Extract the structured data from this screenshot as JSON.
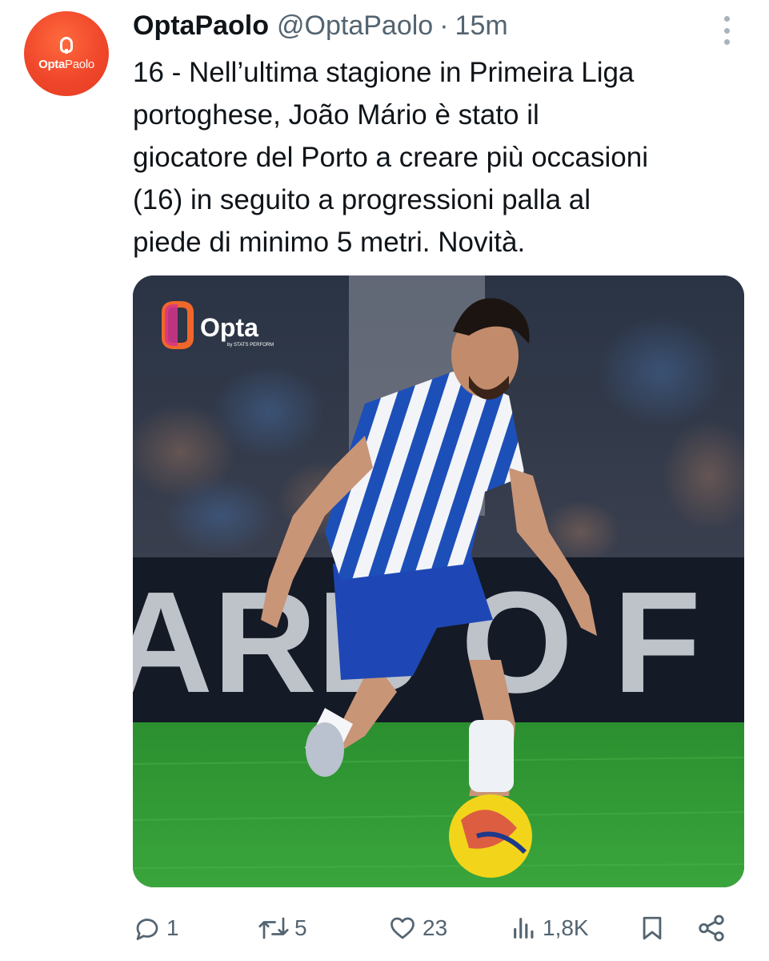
{
  "author": {
    "display_name": "OptaPaolo",
    "handle": "@OptaPaolo",
    "separator": "·",
    "time": "15m",
    "avatar_brand_bold": "Opta",
    "avatar_brand_light": "Paolo",
    "avatar_color": "#f0472b"
  },
  "tweet": {
    "text": "16 - Nell’ultima stagione in Primeira Liga\nportoghese, João Mário è stato il\ngiocatore del Porto a creare più occasioni\n(16) in seguito a progressioni palla al\npiede di minimo 5 metri. Novità."
  },
  "media": {
    "logo_text": "Opta",
    "logo_subtext": "by STATS PERFORM",
    "banner_text": "ARB O F",
    "description_icons": [
      "opta-logo-icon",
      "player-photo",
      "football-icon"
    ]
  },
  "actions": {
    "reply_count": "1",
    "retweet_count": "5",
    "like_count": "23",
    "views_count": "1,8K",
    "icons": [
      "reply-icon",
      "retweet-icon",
      "heart-icon",
      "views-icon",
      "bookmark-icon",
      "share-icon"
    ]
  },
  "colors": {
    "text": "#0f1419",
    "muted": "#536471",
    "porto_blue": "#1d4fb8",
    "pitch_green": "#2f9a34"
  }
}
